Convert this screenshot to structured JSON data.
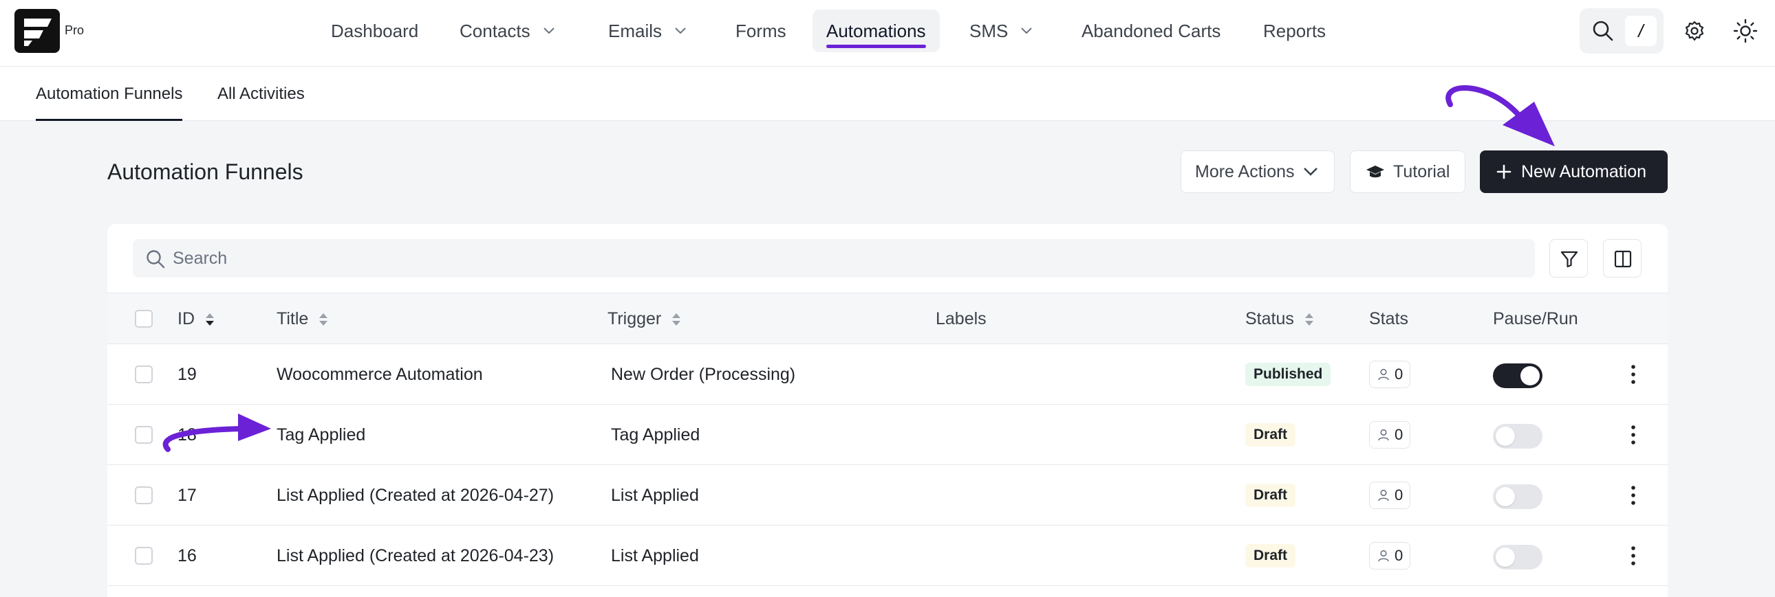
{
  "app": {
    "logo_sub": "Pro"
  },
  "nav": {
    "items": [
      {
        "label": "Dashboard",
        "has_dropdown": false,
        "active": false
      },
      {
        "label": "Contacts",
        "has_dropdown": true,
        "active": false
      },
      {
        "label": "Emails",
        "has_dropdown": true,
        "active": false
      },
      {
        "label": "Forms",
        "has_dropdown": false,
        "active": false
      },
      {
        "label": "Automations",
        "has_dropdown": false,
        "active": true
      },
      {
        "label": "SMS",
        "has_dropdown": true,
        "active": false
      },
      {
        "label": "Abandoned Carts",
        "has_dropdown": false,
        "active": false
      },
      {
        "label": "Reports",
        "has_dropdown": false,
        "active": false
      }
    ],
    "search_shortcut": "/"
  },
  "subtabs": [
    {
      "label": "Automation Funnels",
      "active": true
    },
    {
      "label": "All Activities",
      "active": false
    }
  ],
  "page": {
    "title": "Automation Funnels",
    "more_actions_label": "More Actions",
    "tutorial_label": "Tutorial",
    "new_automation_label": "New Automation"
  },
  "search": {
    "placeholder": "Search",
    "value": ""
  },
  "table": {
    "columns": {
      "id": "ID",
      "title": "Title",
      "trigger": "Trigger",
      "labels": "Labels",
      "status": "Status",
      "stats": "Stats",
      "pause_run": "Pause/Run"
    },
    "rows": [
      {
        "id": "19",
        "title": "Woocommerce Automation",
        "trigger": "New Order (Processing)",
        "status": "Published",
        "stats": "0",
        "running": true
      },
      {
        "id": "18",
        "title": "Tag Applied",
        "trigger": "Tag Applied",
        "status": "Draft",
        "stats": "0",
        "running": false
      },
      {
        "id": "17",
        "title": "List Applied (Created at 2026-04-27)",
        "trigger": "List Applied",
        "status": "Draft",
        "stats": "0",
        "running": false
      },
      {
        "id": "16",
        "title": "List Applied (Created at 2026-04-23)",
        "trigger": "List Applied",
        "status": "Draft",
        "stats": "0",
        "running": false
      }
    ]
  },
  "colors": {
    "accent": "#6b21d6",
    "primary_button": "#1d2029",
    "published_badge": "#e6f7ee",
    "draft_badge": "#fdf8e6"
  }
}
